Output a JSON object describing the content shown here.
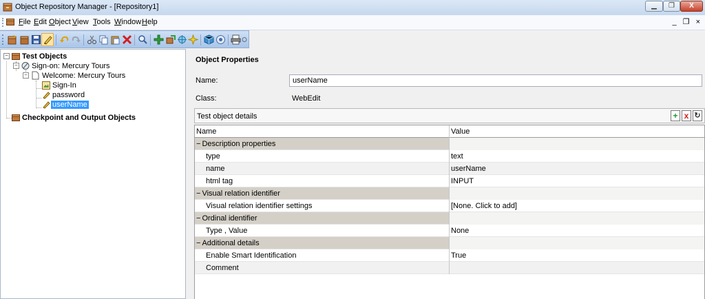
{
  "window": {
    "title": "Object Repository Manager - [Repository1]",
    "min_glyph": "▁",
    "max_glyph": "❐",
    "close_glyph": "X"
  },
  "menu": {
    "items": [
      {
        "label": "File",
        "accel": "F"
      },
      {
        "label": "Edit",
        "accel": "E"
      },
      {
        "label": "Object",
        "accel": "O"
      },
      {
        "label": "View",
        "accel": "V"
      },
      {
        "label": "Tools",
        "accel": "T"
      },
      {
        "label": "Window",
        "accel": "W"
      },
      {
        "label": "Help",
        "accel": "H"
      }
    ],
    "mdi_controls": "_ ❐ ×"
  },
  "toolbar": {
    "icons": [
      "new-repository-icon",
      "open-icon",
      "save-icon",
      "edit-icon",
      "undo-icon",
      "redo-icon",
      "cut-icon",
      "copy-icon",
      "paste-icon",
      "delete-icon",
      "find-icon",
      "add-objects-icon",
      "navigate-icon",
      "highlight-icon",
      "define-object-icon",
      "object-spy-icon",
      "local-objects-icon",
      "print-icon",
      "associate-icon"
    ]
  },
  "tree": {
    "root": "Test Objects",
    "page_parent": "Sign-on: Mercury Tours",
    "page": "Welcome: Mercury Tours",
    "children": [
      "Sign-In",
      "password",
      "userName"
    ],
    "selected": "userName",
    "second_root": "Checkpoint and Output Objects"
  },
  "properties": {
    "title": "Object Properties",
    "name_label": "Name:",
    "name_value": "userName",
    "class_label": "Class:",
    "class_value": "WebEdit",
    "details_label": "Test object details",
    "add_glyph": "+",
    "remove_glyph": "x",
    "refresh_glyph": "↻"
  },
  "grid": {
    "header": {
      "name": "Name",
      "value": "Value"
    },
    "rows": [
      {
        "kind": "cat",
        "name": "Description properties",
        "value": ""
      },
      {
        "kind": "prop",
        "name": "type",
        "value": "text"
      },
      {
        "kind": "prop",
        "name": "name",
        "value": "userName"
      },
      {
        "kind": "prop",
        "name": "html tag",
        "value": "INPUT"
      },
      {
        "kind": "cat",
        "name": "Visual relation identifier",
        "value": ""
      },
      {
        "kind": "prop",
        "name": "Visual relation identifier settings",
        "value": "[None. Click to add]"
      },
      {
        "kind": "cat",
        "name": "Ordinal identifier",
        "value": ""
      },
      {
        "kind": "prop",
        "name": "Type , Value",
        "value": "None"
      },
      {
        "kind": "cat",
        "name": "Additional details",
        "value": ""
      },
      {
        "kind": "prop",
        "name": "Enable Smart Identification",
        "value": "True"
      },
      {
        "kind": "prop",
        "name": "Comment",
        "value": ""
      }
    ],
    "collapse_glyph": "−"
  }
}
